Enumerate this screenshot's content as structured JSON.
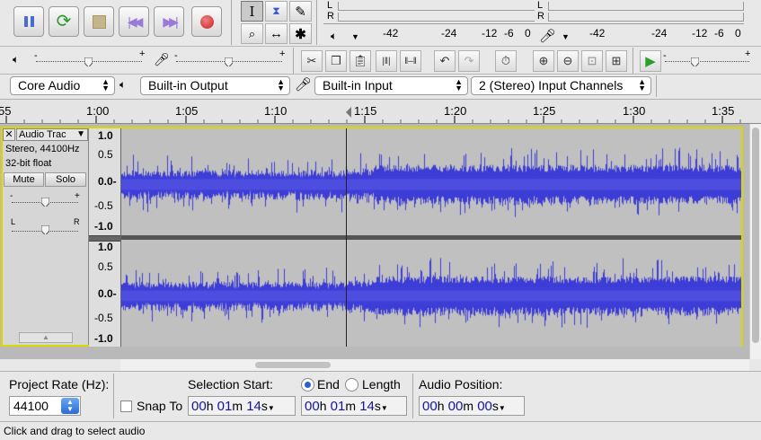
{
  "toolbar": {
    "meter_play": {
      "left": "L",
      "right": "R",
      "ticks": [
        "-42",
        "-24",
        "-12",
        "-6",
        "0"
      ]
    },
    "meter_rec": {
      "left": "L",
      "right": "R",
      "ticks": [
        "-42",
        "-24",
        "-12",
        "-6",
        "0"
      ]
    }
  },
  "devices": {
    "host": "Core Audio",
    "output": "Built-in Output",
    "input": "Built-in Input",
    "channels": "2 (Stereo) Input Channels"
  },
  "ruler": {
    "labels": [
      "55",
      "1:00",
      "1:05",
      "1:10",
      "1:15",
      "1:20",
      "1:25",
      "1:30",
      "1:35"
    ]
  },
  "track": {
    "name": "Audio Trac",
    "info_line1": "Stereo, 44100Hz",
    "info_line2": "32-bit float",
    "mute_label": "Mute",
    "solo_label": "Solo",
    "gain_minus": "-",
    "gain_plus": "+",
    "pan_left": "L",
    "pan_right": "R",
    "scale_top": [
      "1.0",
      "0.5",
      "0.0-",
      "-0.5",
      "-1.0"
    ],
    "scale_bottom": [
      "1.0",
      "0.5",
      "0.0-",
      "-0.5",
      "-1.0"
    ]
  },
  "selection_bar": {
    "project_rate_label": "Project Rate (Hz):",
    "project_rate_value": "44100",
    "snap_to_label": "Snap To",
    "selection_start_label": "Selection Start:",
    "end_label": "End",
    "length_label": "Length",
    "audio_position_label": "Audio Position:",
    "start_time": {
      "h": "00",
      "hu": "h",
      "m": "01",
      "mu": "m",
      "s": "14",
      "su": "s"
    },
    "end_time": {
      "h": "00",
      "hu": "h",
      "m": "01",
      "mu": "m",
      "s": "14",
      "su": "s"
    },
    "audio_position": {
      "h": "00",
      "hu": "h",
      "m": "00",
      "mu": "m",
      "s": "00",
      "su": "s"
    }
  },
  "status": {
    "text": "Click and drag to select audio"
  },
  "colors": {
    "waveform": "#3c3cd7",
    "track_bg": "#c0c0c0",
    "selected_border": "#dcdc00"
  }
}
